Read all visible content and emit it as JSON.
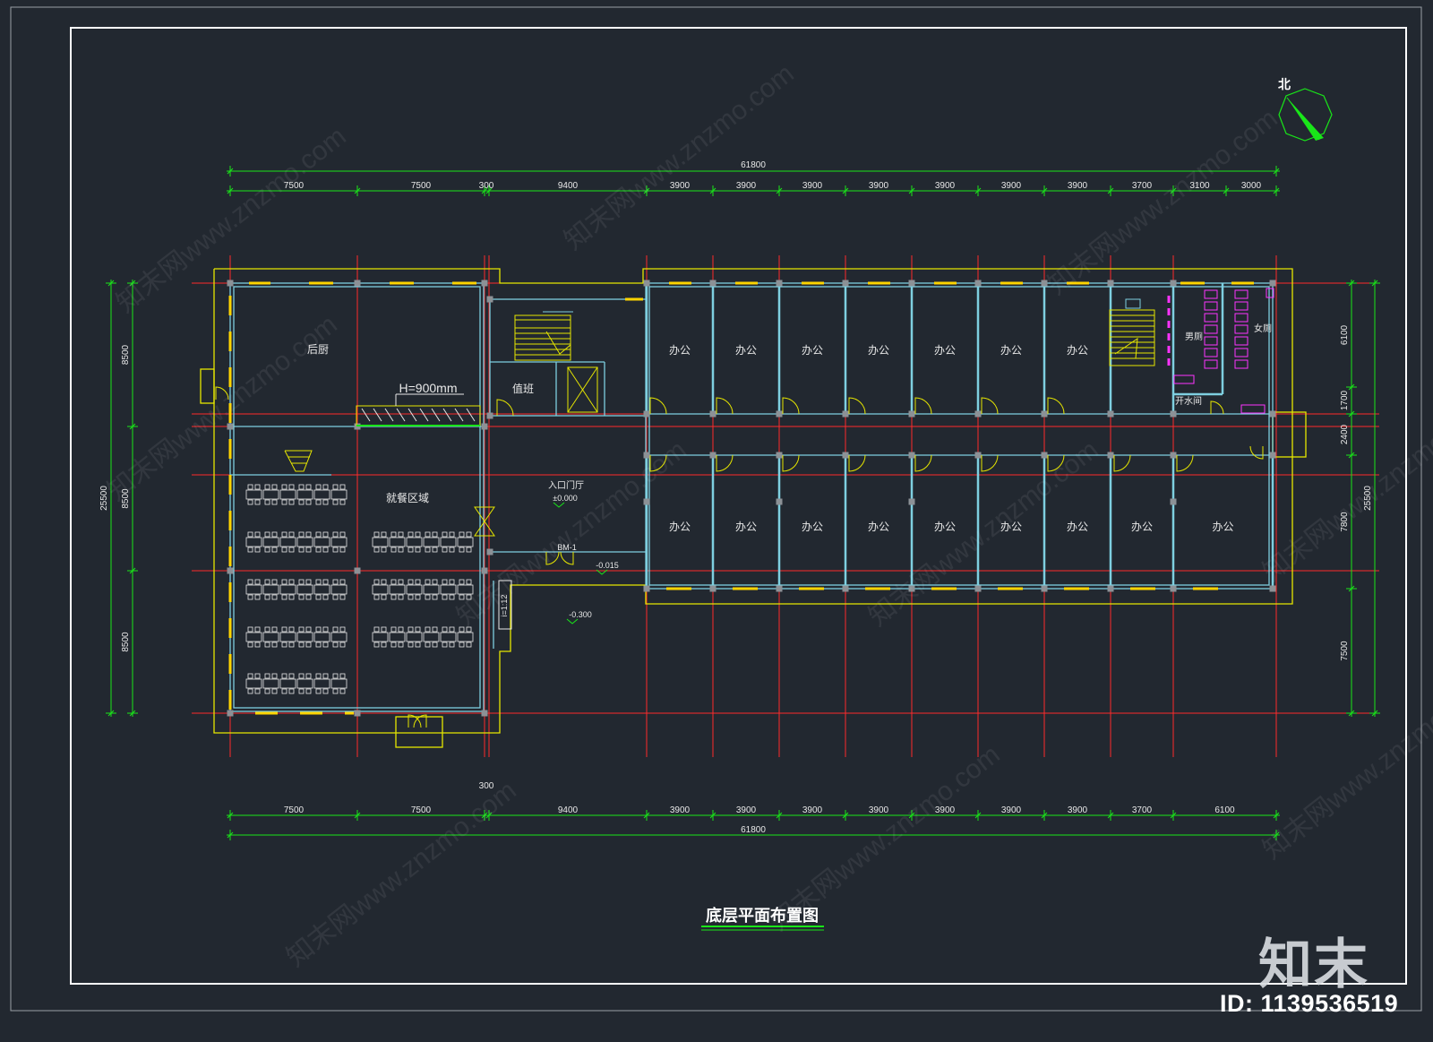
{
  "drawing": {
    "title": "底层平面布置图",
    "north_label": "北",
    "overall_width": "61800",
    "overall_depth": "25500",
    "top_dims": [
      "7500",
      "7500",
      "300",
      "9400",
      "3900",
      "3900",
      "3900",
      "3900",
      "3900",
      "3900",
      "3900",
      "3700",
      "3100",
      "3000"
    ],
    "bottom_dims": [
      "7500",
      "7500",
      "300",
      "9400",
      "3900",
      "3900",
      "3900",
      "3900",
      "3900",
      "3900",
      "3900",
      "3700",
      "6100"
    ],
    "left_dims": [
      "8500",
      "8500",
      "8500"
    ],
    "right_dims": [
      "6100",
      "1700",
      "2400",
      "7800",
      "7500"
    ],
    "rooms": {
      "kitchen": "后厨",
      "dining": "就餐区域",
      "duty": "值班",
      "lobby": "入口门厅",
      "office": "办公",
      "mens_wc": "男厕",
      "womens_wc": "女厕",
      "water_room": "开水间"
    },
    "notes": {
      "counter_height": "H=900mm",
      "lobby_level": "±0.000",
      "door_tag": "BM-1",
      "level_1": "-0.015",
      "level_2": "-0.300",
      "ramp_tag": "i=1:12"
    }
  },
  "watermark": {
    "brand": "知末",
    "id_label": "ID: 1139536519",
    "site_text": "知末网www.znzmo.com"
  },
  "colors": {
    "background": "#222830",
    "wall": "#7ecfe0",
    "outline": "#e6e600",
    "dimension": "#19e619",
    "axis": "#ff2a2a",
    "window": "#ffd400",
    "door": "#e6e600",
    "fixture": "#ff33ff",
    "text": "#e8e8e8"
  }
}
